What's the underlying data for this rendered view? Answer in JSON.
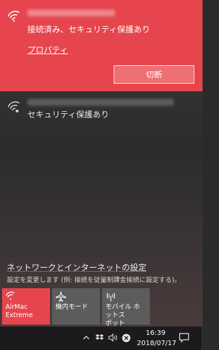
{
  "networks": {
    "connected": {
      "status": "接続済み、セキュリティ保護あり",
      "properties_link": "プロパティ",
      "disconnect_label": "切断"
    },
    "other": {
      "status": "セキュリティ保護あり"
    }
  },
  "settings": {
    "title": "ネットワークとインターネットの設定",
    "description": "設定を変更します (例: 接続を従量制課金接続に設定する)。"
  },
  "quick_actions": [
    {
      "label": "AirMac\nExtreme",
      "icon": "wifi-icon",
      "active": true
    },
    {
      "label": "機内モード",
      "icon": "airplane-icon",
      "active": false
    },
    {
      "label": "モバイル ホットス\nポット",
      "icon": "hotspot-icon",
      "active": false
    }
  ],
  "taskbar": {
    "time": "16:39",
    "date": "2018/07/17",
    "icons": [
      "chevron-up-icon",
      "dropbox-icon",
      "volume-icon",
      "close-circle-icon",
      "action-center-icon"
    ]
  },
  "colors": {
    "accent": "#e6454d",
    "tile_inactive": "#5c5c5c",
    "taskbar": "#1c1a1c"
  }
}
